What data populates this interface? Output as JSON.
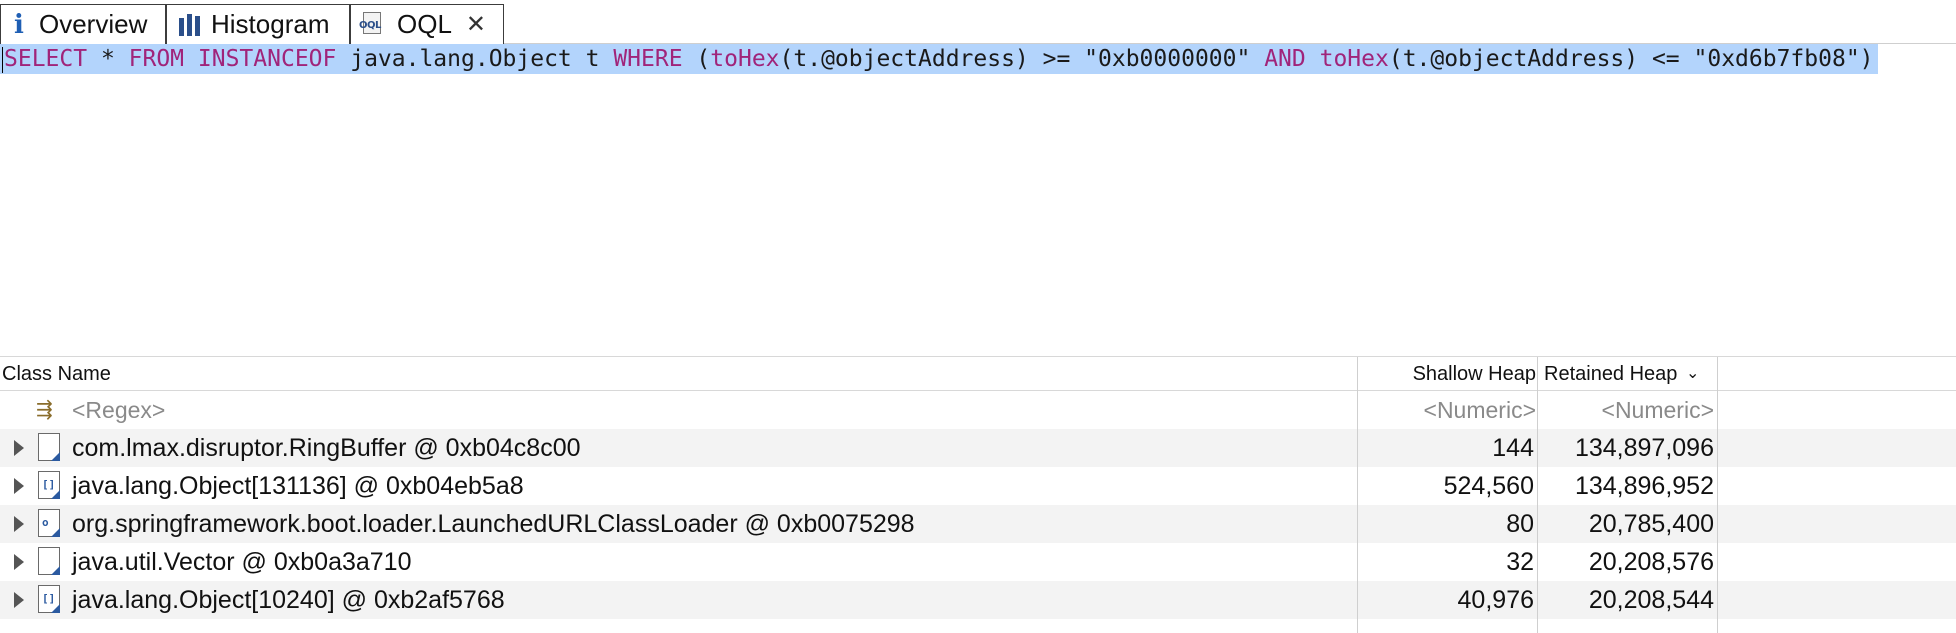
{
  "tabs": [
    {
      "label": "Overview",
      "icon": "info-icon"
    },
    {
      "label": "Histogram",
      "icon": "histogram-icon"
    },
    {
      "label": "OQL",
      "icon": "oql-icon",
      "active": true
    }
  ],
  "query": {
    "parts": [
      {
        "t": "SELECT",
        "c": "kw"
      },
      {
        "t": " * ",
        "c": "plain"
      },
      {
        "t": "FROM",
        "c": "kw"
      },
      {
        "t": " ",
        "c": "plain"
      },
      {
        "t": "INSTANCEOF",
        "c": "kw"
      },
      {
        "t": " java.lang.Object t ",
        "c": "plain"
      },
      {
        "t": "WHERE",
        "c": "kw"
      },
      {
        "t": " (",
        "c": "plain"
      },
      {
        "t": "toHex",
        "c": "fn"
      },
      {
        "t": "(t.@objectAddress) >= ",
        "c": "plain"
      },
      {
        "t": "\"0xb0000000\"",
        "c": "str"
      },
      {
        "t": " ",
        "c": "plain"
      },
      {
        "t": "AND",
        "c": "kw"
      },
      {
        "t": " ",
        "c": "plain"
      },
      {
        "t": "toHex",
        "c": "fn"
      },
      {
        "t": "(t.@objectAddress) <= ",
        "c": "plain"
      },
      {
        "t": "\"0xd6b7fb08\"",
        "c": "str"
      },
      {
        "t": ")",
        "c": "plain"
      }
    ],
    "highlight_color": "#b3d4fc",
    "keyword_color": "#a0247a"
  },
  "table": {
    "headers": {
      "class_name": "Class Name",
      "shallow_heap": "Shallow Heap",
      "retained_heap": "Retained Heap"
    },
    "filter_row": {
      "class_name": "<Regex>",
      "shallow_heap": "<Numeric>",
      "retained_heap": "<Numeric>"
    },
    "rows": [
      {
        "class_name": "com.lmax.disruptor.RingBuffer @ 0xb04c8c00",
        "shallow_heap": "144",
        "retained_heap": "134,897,096",
        "icon_mark": ""
      },
      {
        "class_name": "java.lang.Object[131136] @ 0xb04eb5a8",
        "shallow_heap": "524,560",
        "retained_heap": "134,896,952",
        "icon_mark": "[]"
      },
      {
        "class_name": "org.springframework.boot.loader.LaunchedURLClassLoader @ 0xb0075298",
        "shallow_heap": "80",
        "retained_heap": "20,785,400",
        "icon_mark": "o"
      },
      {
        "class_name": "java.util.Vector @ 0xb0a3a710",
        "shallow_heap": "32",
        "retained_heap": "20,208,576",
        "icon_mark": ""
      },
      {
        "class_name": "java.lang.Object[10240] @ 0xb2af5768",
        "shallow_heap": "40,976",
        "retained_heap": "20,208,544",
        "icon_mark": "[]"
      }
    ]
  }
}
